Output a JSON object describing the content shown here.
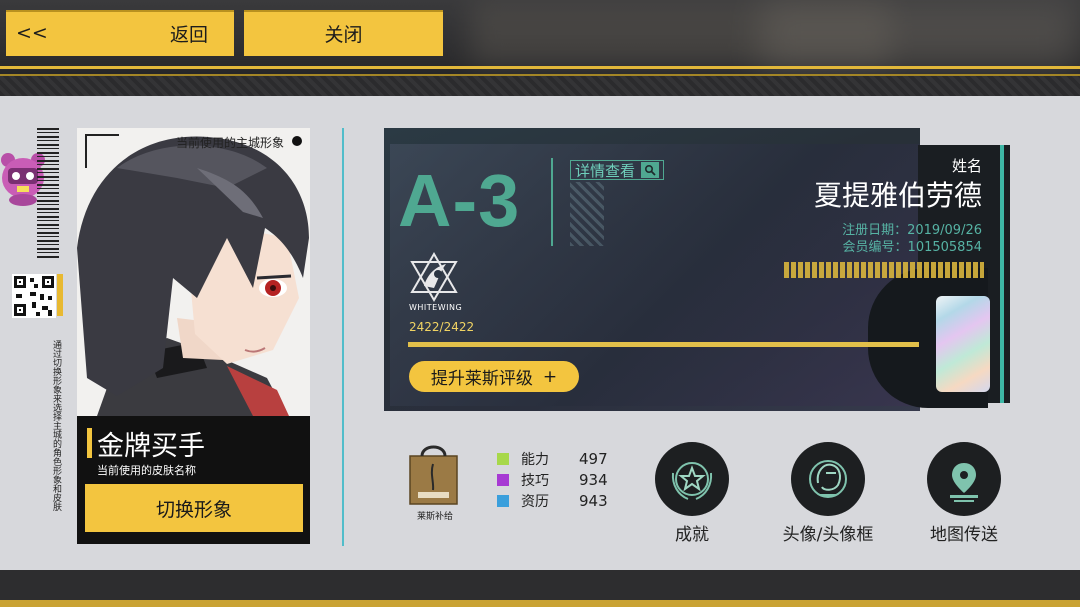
{
  "topbar": {
    "back_arrow": "<<",
    "back_label": "返回",
    "close_label": "关闭"
  },
  "character": {
    "portrait_caption": "当前使用的主城形象",
    "skin_name": "金牌买手",
    "skin_subtitle": "当前使用的皮肤名称",
    "switch_label": "切换形象",
    "side_hint": "通过切换形象来选择主城的角色形象和皮肤"
  },
  "id_card": {
    "grade": "A-3",
    "detail_label": "详情查看",
    "guild_name": "WHITEWING",
    "exp": "2422/2422",
    "upgrade_label": "提升莱斯评级",
    "upgrade_plus": "+",
    "name_label": "姓名",
    "player_name": "夏提雅伯劳德",
    "reg_date": "注册日期：2019/09/26",
    "member_no": "会员编号：101505854"
  },
  "supply": {
    "label": "莱斯补给",
    "icon": "gift-bag-icon"
  },
  "stats": [
    {
      "label": "能力",
      "value": "497",
      "color": "#a7d84a"
    },
    {
      "label": "技巧",
      "value": "934",
      "color": "#a739d3"
    },
    {
      "label": "资历",
      "value": "943",
      "color": "#3a9fdc"
    }
  ],
  "actions": [
    {
      "label": "成就",
      "icon": "star-laurel-icon"
    },
    {
      "label": "头像/头像框",
      "icon": "avatar-portrait-icon"
    },
    {
      "label": "地图传送",
      "icon": "map-pin-icon"
    }
  ],
  "colors": {
    "accent_yellow": "#f3c53f",
    "teal": "#4fa891",
    "panel_bg": "#d7d8dc"
  }
}
